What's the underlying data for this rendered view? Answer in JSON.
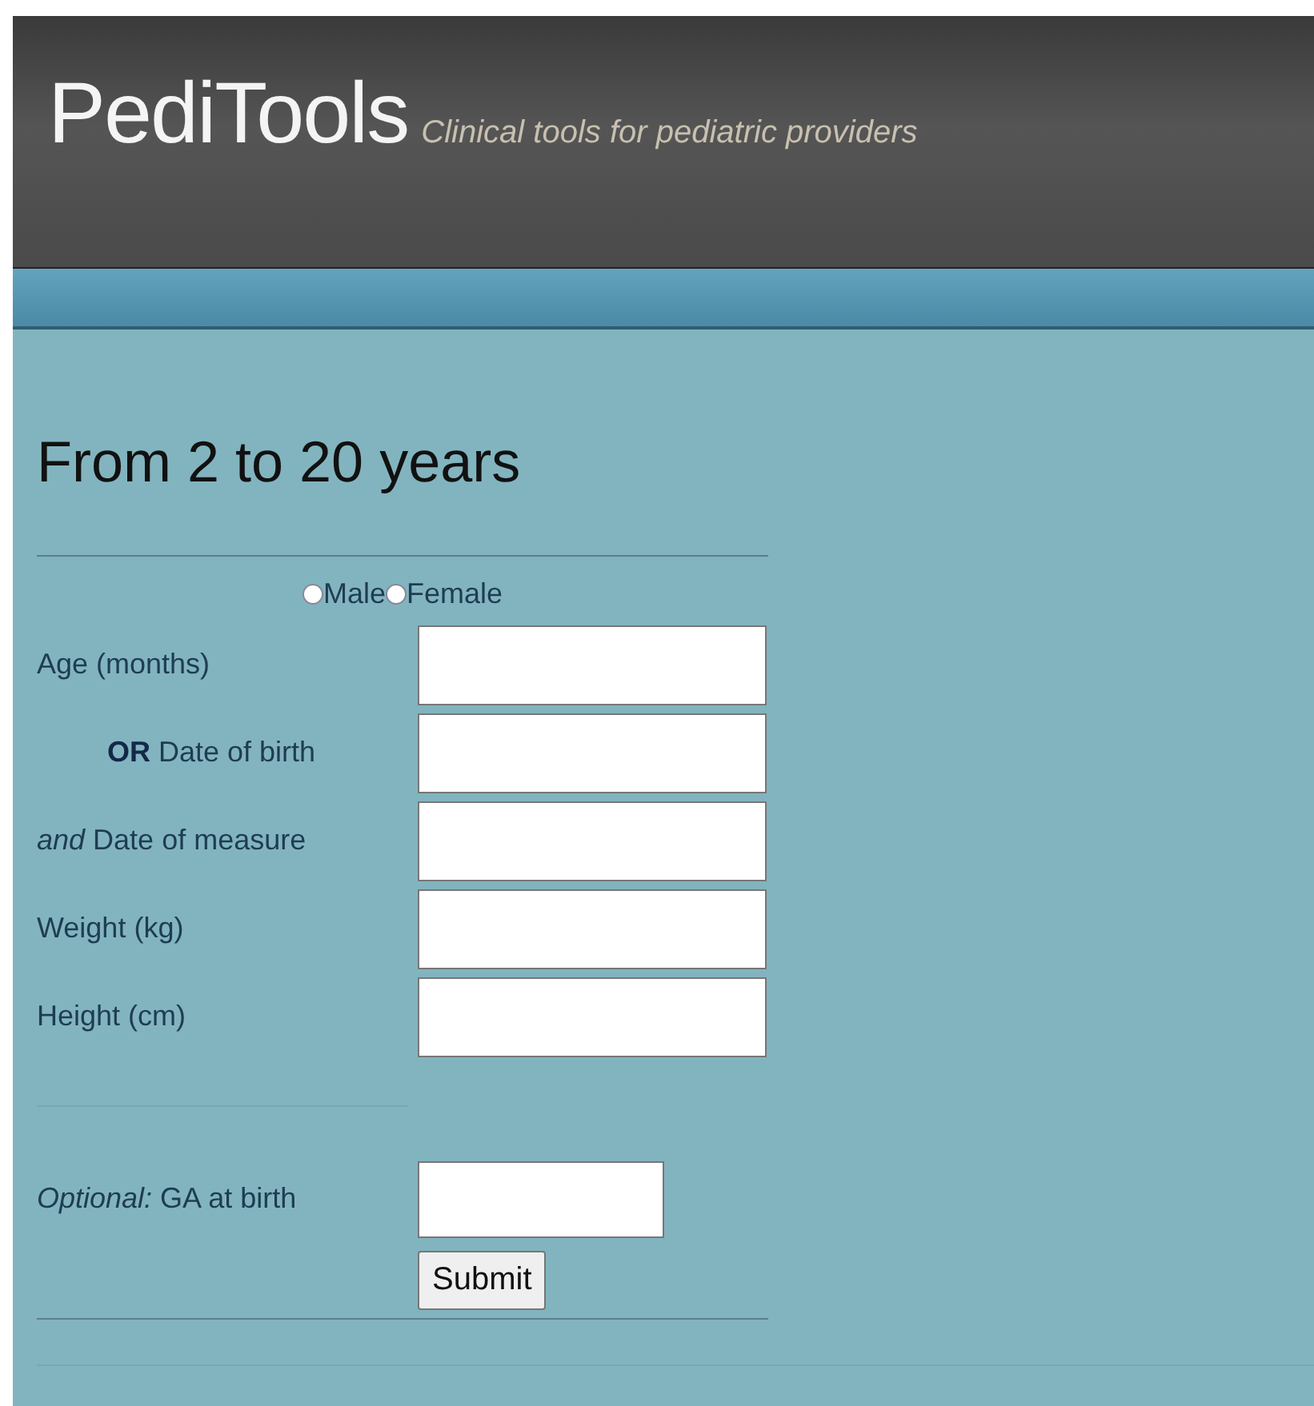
{
  "header": {
    "logo": "PediTools",
    "tagline": "Clinical tools for pediatric providers"
  },
  "heading": "From 2 to 20 years",
  "sex_options": [
    {
      "label": "Male",
      "selected": false
    },
    {
      "label": "Female",
      "selected": false
    }
  ],
  "fields": [
    {
      "label": "Age (months)",
      "indent": false
    },
    {
      "label": "**OR** Date of birth",
      "indent": true
    },
    {
      "label": "*and* Date of measure",
      "indent": false
    },
    {
      "label": "Weight (kg)",
      "indent": false
    },
    {
      "label": "Height (cm)",
      "indent": false
    }
  ],
  "optional_field": {
    "label": "*Optional:* GA at birth"
  },
  "submit_button": "Submit"
}
